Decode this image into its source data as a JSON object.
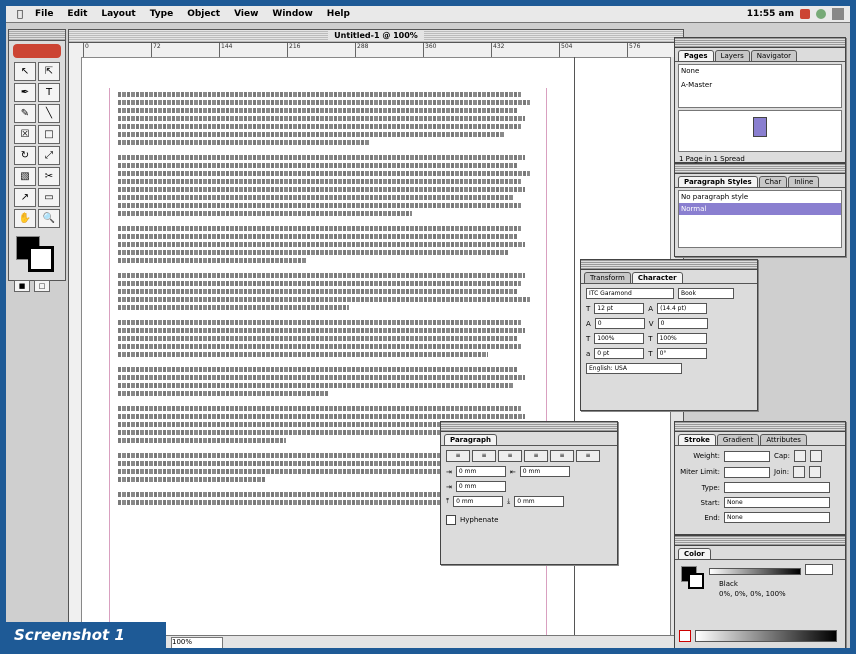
{
  "menubar": {
    "apple": "",
    "items": [
      "File",
      "Edit",
      "Layout",
      "Type",
      "Object",
      "View",
      "Window",
      "Help"
    ],
    "clock": "11:55 am"
  },
  "document": {
    "title": "Untitled-1 @ 100%",
    "ruler_ticks": [
      "0",
      "72",
      "144",
      "216",
      "288",
      "360",
      "432",
      "504",
      "576"
    ],
    "page_field": "100%"
  },
  "pages_palette": {
    "tabs": [
      "Pages",
      "Layers",
      "Navigator"
    ],
    "items": [
      "None",
      "A-Master"
    ],
    "status": "1 Page in 1 Spread"
  },
  "paragraph_styles": {
    "tabs": [
      "Paragraph Styles",
      "Char",
      "Inline"
    ],
    "items": [
      "No paragraph style",
      "Normal"
    ]
  },
  "character_palette": {
    "tabs": [
      "Transform",
      "Character"
    ],
    "font": "ITC Garamond",
    "style": "Book",
    "size": "12 pt",
    "leading": "(14.4 pt)",
    "tracking": "0",
    "kerning": "0",
    "vscale": "100%",
    "hscale": "100%",
    "baseline": "0 pt",
    "skew": "0°",
    "language": "English: USA"
  },
  "paragraph_palette": {
    "title": "Paragraph",
    "left_indent": "0 mm",
    "right_indent": "0 mm",
    "first_indent": "0 mm",
    "space_before": "0 mm",
    "space_after": "0 mm",
    "hyphenate": "Hyphenate"
  },
  "stroke_palette": {
    "tabs": [
      "Stroke",
      "Gradient",
      "Attributes"
    ],
    "weight_label": "Weight:",
    "cap_label": "Cap:",
    "miter_label": "Miter Limit:",
    "join_label": "Join:",
    "type_label": "Type:",
    "start_label": "Start:",
    "end_label": "End:",
    "start_value": "None",
    "end_value": "None"
  },
  "color_palette": {
    "title": "Color",
    "name": "Black",
    "values": "0%, 0%, 0%, 100%"
  },
  "caption": "Screenshot 1"
}
